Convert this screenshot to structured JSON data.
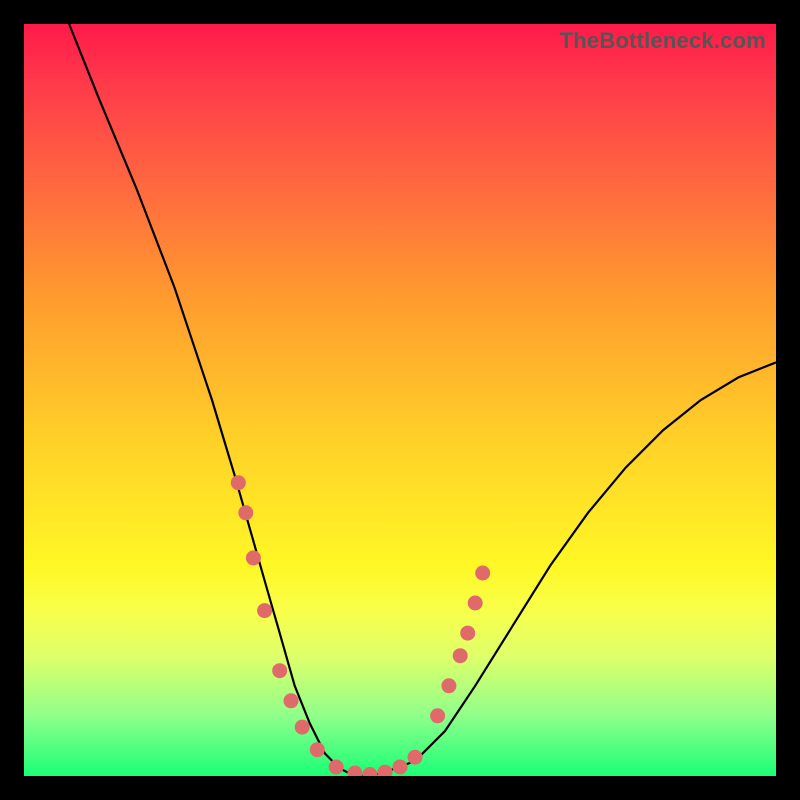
{
  "watermark": "TheBottleneck.com",
  "chart_data": {
    "type": "line",
    "title": "",
    "xlabel": "",
    "ylabel": "",
    "xlim": [
      0,
      100
    ],
    "ylim": [
      0,
      100
    ],
    "series": [
      {
        "name": "curve",
        "x": [
          6,
          10,
          15,
          20,
          25,
          28,
          30,
          32,
          34,
          36,
          38,
          40,
          42,
          44,
          46,
          48,
          52,
          56,
          60,
          65,
          70,
          75,
          80,
          85,
          90,
          95,
          100
        ],
        "y": [
          100,
          90,
          78,
          65,
          50,
          40,
          33,
          26,
          19,
          12,
          7,
          3,
          1,
          0,
          0,
          0.5,
          2,
          6,
          12,
          20,
          28,
          35,
          41,
          46,
          50,
          53,
          55
        ]
      }
    ],
    "markers": [
      {
        "x": 28.5,
        "y": 39
      },
      {
        "x": 29.5,
        "y": 35
      },
      {
        "x": 30.5,
        "y": 29
      },
      {
        "x": 32.0,
        "y": 22
      },
      {
        "x": 34.0,
        "y": 14
      },
      {
        "x": 35.5,
        "y": 10
      },
      {
        "x": 37.0,
        "y": 6.5
      },
      {
        "x": 39.0,
        "y": 3.5
      },
      {
        "x": 41.5,
        "y": 1.2
      },
      {
        "x": 44.0,
        "y": 0.4
      },
      {
        "x": 46.0,
        "y": 0.2
      },
      {
        "x": 48.0,
        "y": 0.5
      },
      {
        "x": 50.0,
        "y": 1.2
      },
      {
        "x": 52.0,
        "y": 2.5
      },
      {
        "x": 55.0,
        "y": 8
      },
      {
        "x": 56.5,
        "y": 12
      },
      {
        "x": 58.0,
        "y": 16
      },
      {
        "x": 59.0,
        "y": 19
      },
      {
        "x": 60.0,
        "y": 23
      },
      {
        "x": 61.0,
        "y": 27
      }
    ],
    "marker_color": "#e06a6a",
    "curve_color": "#000000"
  }
}
